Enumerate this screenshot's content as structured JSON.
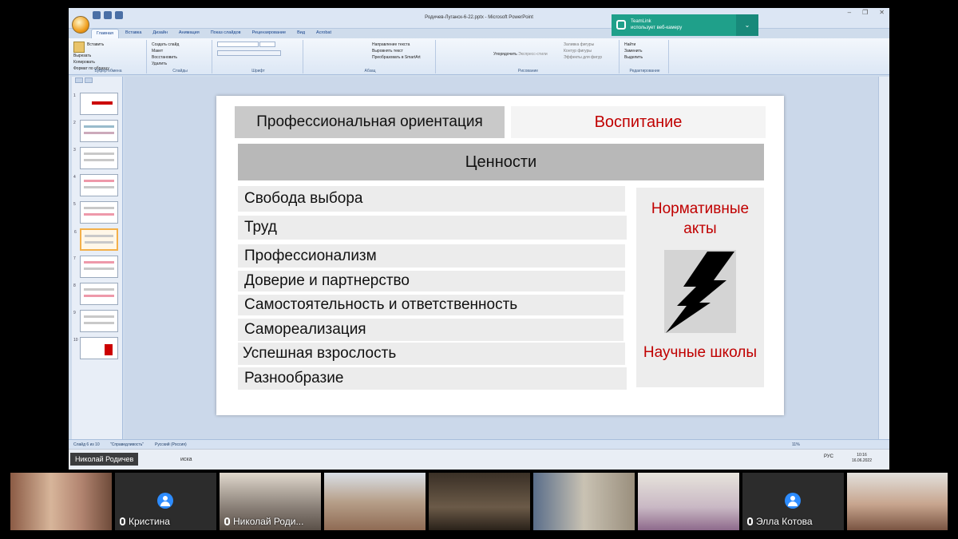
{
  "window": {
    "title": "Родичев-Луганск-6-22.pptx - Microsoft PowerPoint",
    "controls": [
      "–",
      "❐",
      "✕"
    ]
  },
  "ribbon": {
    "tabs": [
      "Главная",
      "Вставка",
      "Дизайн",
      "Анимация",
      "Показ слайдов",
      "Рецензирование",
      "Вид",
      "Acrobat"
    ],
    "groups": {
      "clipboard": {
        "label": "Буфер обмена",
        "paste": "Вставить",
        "cut": "Вырезать",
        "copy": "Копировать",
        "format": "Формат по образцу"
      },
      "slides": {
        "label": "Слайды",
        "create": "Создать слайд",
        "layout": "Макет",
        "reset": "Восстановить",
        "delete": "Удалить"
      },
      "font": {
        "label": "Шрифт"
      },
      "paragraph": {
        "label": "Абзац",
        "direction": "Направление текста",
        "align": "Выровнять текст",
        "smartart": "Преобразовать в SmartArt"
      },
      "drawing": {
        "label": "Рисование",
        "arrange": "Упорядочить",
        "styles": "Экспресс-стили",
        "fill": "Заливка фигуры",
        "outline": "Контур фигуры",
        "effects": "Эффекты для фигур"
      },
      "editing": {
        "label": "Редактирование",
        "find": "Найти",
        "replace": "Заменить",
        "select": "Выделить"
      }
    }
  },
  "toast": {
    "title": "TeamLink",
    "text": "использует веб-камеру"
  },
  "thumbnails": [
    "1",
    "2",
    "3",
    "4",
    "5",
    "6",
    "7",
    "8",
    "9",
    "10"
  ],
  "slide": {
    "left_header": "Профессиональная ориентация",
    "right_header": "Воспитание",
    "center_header": "Ценности",
    "values": [
      "Свобода выбора",
      "Труд",
      "Профессионализм",
      "Доверие и партнерство",
      "Самостоятельность и ответственность",
      "Самореализация",
      "Успешная взрослость",
      "Разнообразие"
    ],
    "side_top": "Нормативные акты",
    "side_bottom": "Научные школы"
  },
  "status": {
    "slide_info": "Слайд 6 из 10",
    "theme": "\"Справедливость\"",
    "lang": "Русский (Россия)",
    "zoom": "11%"
  },
  "taskbar": {
    "speaker": "Николай Родичев",
    "search": "иска",
    "lang": "РУС",
    "time": "10:16",
    "date": "16.06.2022"
  },
  "participants": [
    {
      "name": ""
    },
    {
      "name": "Кристина"
    },
    {
      "name": "Николай Роди..."
    },
    {
      "name": ""
    },
    {
      "name": ""
    },
    {
      "name": ""
    },
    {
      "name": ""
    },
    {
      "name": "Элла Котова"
    },
    {
      "name": ""
    }
  ],
  "colors": {
    "accent_red": "#c00000",
    "toast": "#1fa08a",
    "zoom_blue": "#2d8cff"
  }
}
